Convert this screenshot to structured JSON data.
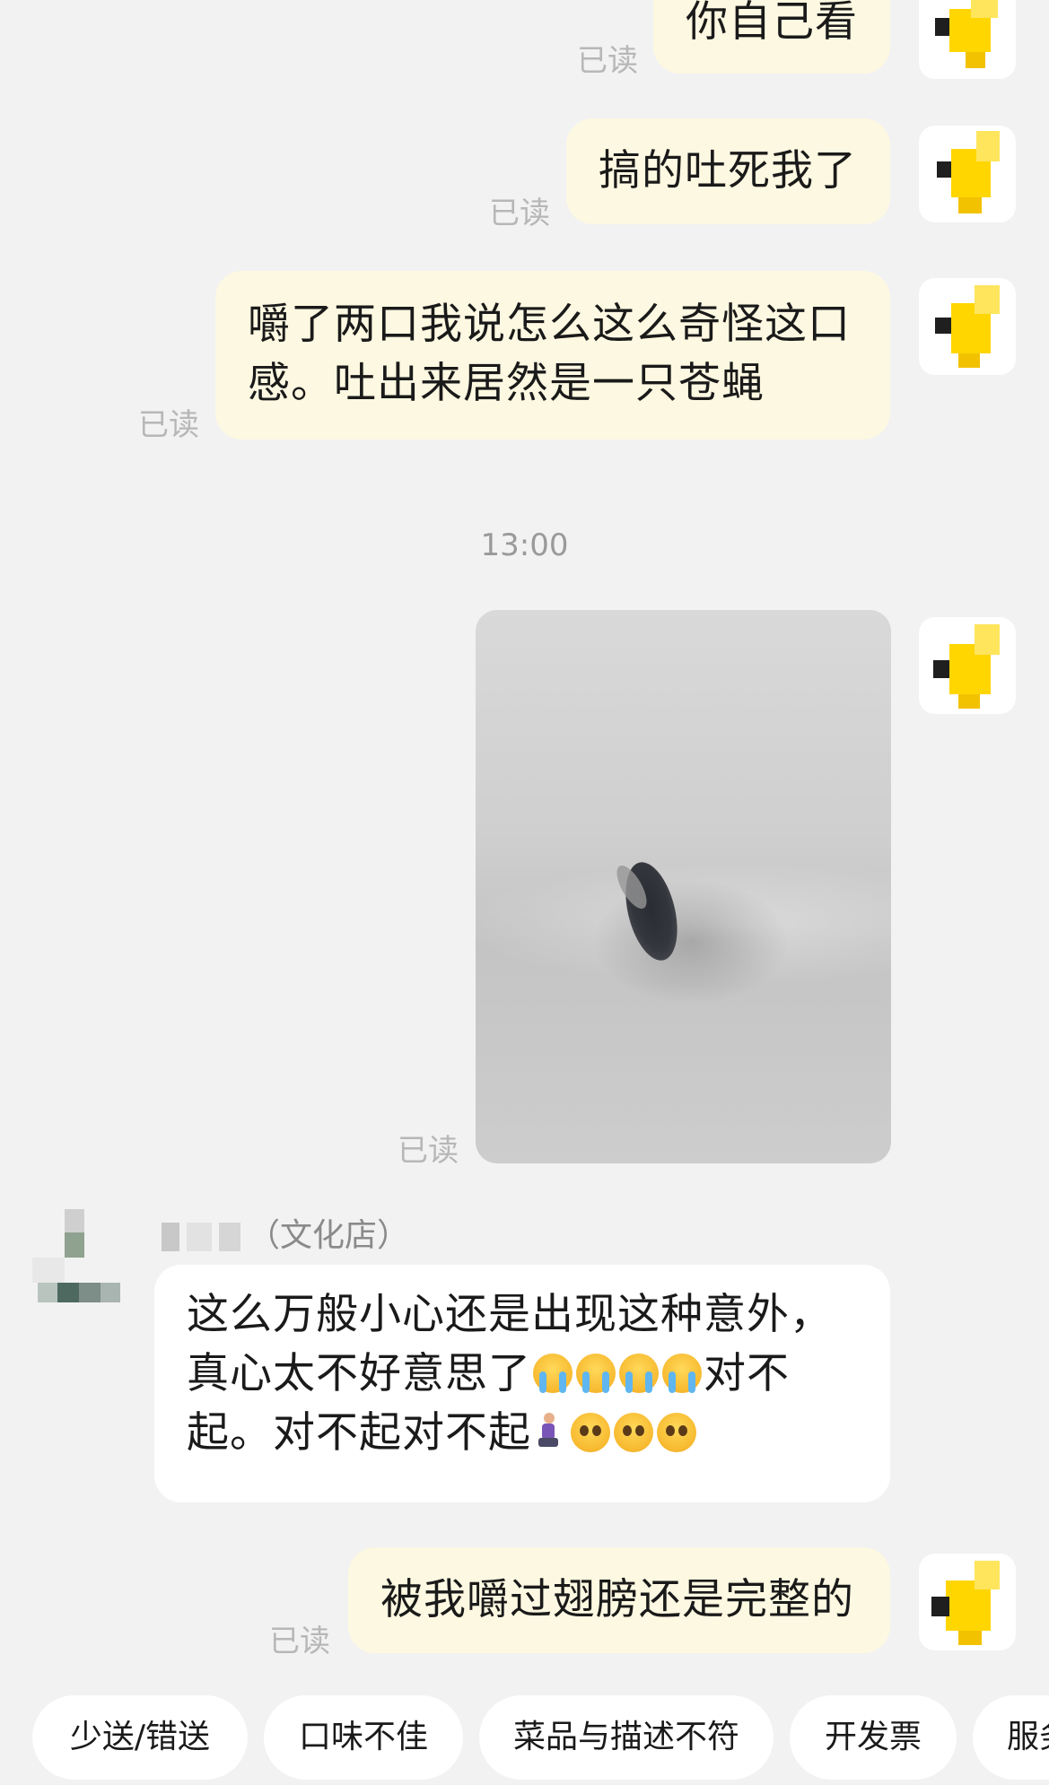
{
  "messages": [
    {
      "text": "你自己看",
      "read": "已读"
    },
    {
      "text": "搞的吐死我了",
      "read": "已读"
    },
    {
      "line1": "嚼了两口我说怎么这么奇怪这口",
      "line2": "感。吐出来居然是一只苍蝇",
      "read": "已读"
    },
    {
      "read": "已读"
    },
    {
      "text": "被我嚼过翅膀还是完整的",
      "read": "已读"
    }
  ],
  "timestamp": "13:00",
  "photo": {
    "label": "fly-photo"
  },
  "merchant": {
    "name": "（文化店）",
    "line1": "这么万般小心还是出现这种意外，",
    "line2_text": "真心太不好意思了",
    "line2_tail": "对不",
    "line3_text": "起。对不起对不起",
    "emoji_cry_count": 4,
    "emoji_plead_count": 3
  },
  "quick_replies": [
    "少送/错送",
    "口味不佳",
    "菜品与描述不符",
    "开发票",
    "服务"
  ],
  "colors": {
    "bubble_outgoing": "#fdf8e1",
    "bubble_incoming": "#ffffff",
    "avatar_yellow": "#ffd600",
    "background": "#f2f2f2"
  }
}
